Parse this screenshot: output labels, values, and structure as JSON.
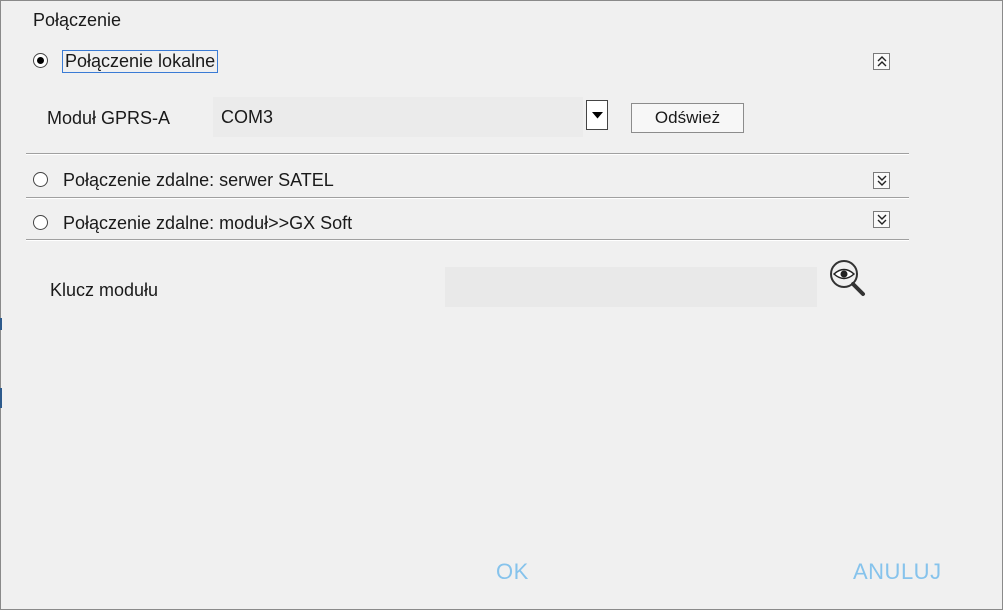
{
  "group": {
    "title": "Połączenie"
  },
  "options": {
    "local": {
      "label": "Połączenie lokalne",
      "selected": true,
      "expander": "collapse-up-icon"
    },
    "remote_satel": {
      "label": "Połączenie zdalne: serwer SATEL",
      "selected": false,
      "expander": "expand-down-icon"
    },
    "remote_gx": {
      "label": "Połączenie zdalne: moduł>>GX Soft",
      "selected": false,
      "expander": "expand-down-icon"
    }
  },
  "local_panel": {
    "module_label": "Moduł GPRS-A",
    "port_value": "COM3",
    "refresh_label": "Odśwież"
  },
  "remote_panel": {
    "key_label": "Klucz modułu",
    "key_value": ""
  },
  "actions": {
    "ok_label": "OK",
    "cancel_label": "ANULUJ"
  },
  "colors": {
    "action_text": "#86c3ec",
    "focus_outline": "#3a7bd5",
    "window_bg": "#f0f0f0"
  }
}
